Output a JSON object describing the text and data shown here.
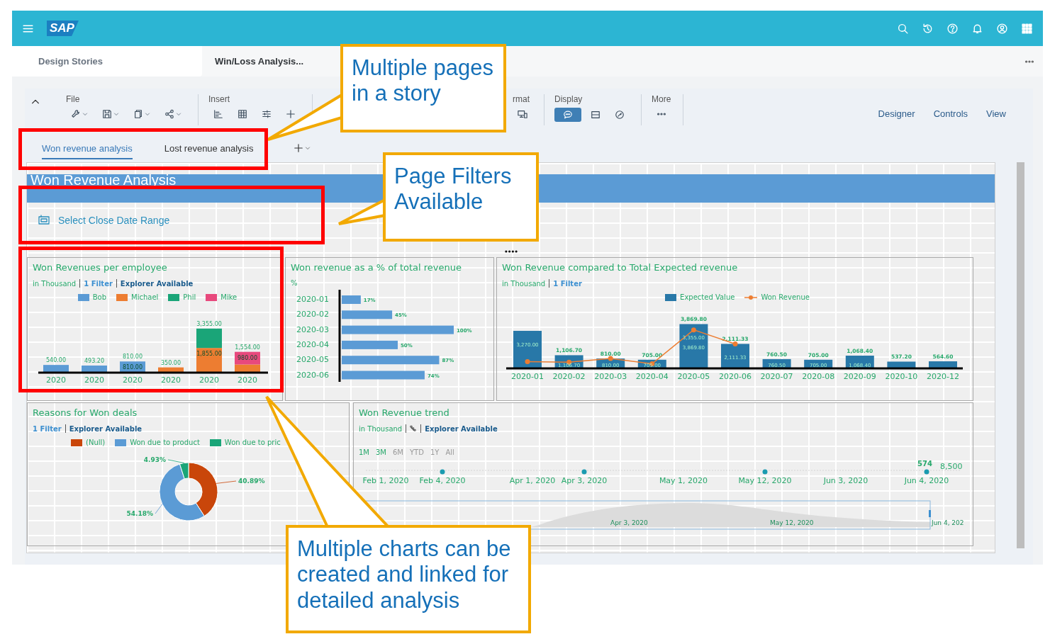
{
  "header": {
    "logo": "SAP",
    "icons": [
      {
        "kind": "search"
      },
      {
        "kind": "history"
      },
      {
        "kind": "help"
      },
      {
        "kind": "bell"
      },
      {
        "kind": "user"
      },
      {
        "kind": "grid"
      }
    ]
  },
  "doc_tabs": [
    {
      "label": "Design Stories",
      "selected": false
    },
    {
      "label": "Win/Loss Analysis...",
      "selected": true
    }
  ],
  "toolbar": {
    "groups": [
      {
        "label": "File",
        "tools": [
          {
            "kind": "wrench",
            "has_menu": true,
            "selected": false
          },
          {
            "kind": "save",
            "has_menu": true,
            "selected": false
          },
          {
            "kind": "copy",
            "has_menu": true,
            "selected": false
          },
          {
            "kind": "share",
            "has_menu": true,
            "selected": false
          }
        ]
      },
      {
        "label": "Insert",
        "tools": [
          {
            "kind": "chart",
            "has_menu": false,
            "selected": false
          },
          {
            "kind": "table",
            "has_menu": false,
            "selected": false
          },
          {
            "kind": "filter",
            "has_menu": false,
            "selected": false
          },
          {
            "kind": "add",
            "has_menu": false,
            "selected": false
          }
        ]
      },
      {
        "label": "rmat",
        "tools": [
          {
            "kind": "device",
            "has_menu": false,
            "selected": false
          }
        ]
      },
      {
        "label": "Display",
        "tools": [
          {
            "kind": "comment",
            "has_menu": false,
            "selected": true
          },
          {
            "kind": "split",
            "has_menu": false,
            "selected": false
          },
          {
            "kind": "gauge",
            "has_menu": false,
            "selected": false
          }
        ]
      },
      {
        "label": "More",
        "tools": [
          {
            "kind": "more",
            "has_menu": false,
            "selected": false
          }
        ]
      }
    ],
    "modes": [
      "Designer",
      "Controls",
      "View"
    ]
  },
  "page_tabs": [
    {
      "label": "Won revenue analysis",
      "selected": true
    },
    {
      "label": "Lost revenue analysis",
      "selected": false
    }
  ],
  "canvas": {
    "banner": "Won Revenue Analysis",
    "filter": "Select Close Date Range",
    "charts": [
      {
        "title": "Won Revenues per employee",
        "subtitle": [
          {
            "kind": "unit",
            "text": "in Thousand"
          },
          {
            "kind": "filter",
            "text": "1 Filter"
          },
          {
            "kind": "explorer",
            "text": "Explorer Available"
          }
        ],
        "chart_data": {
          "type": "bar",
          "stacked": true,
          "categories": [
            "2020",
            "2020",
            "2020",
            "2020",
            "2020",
            "2020"
          ],
          "series": [
            {
              "name": "Bob",
              "color": "#5b9bd5",
              "values": [
                540,
                493.2,
                810,
                null,
                null,
                null
              ],
              "value_labels": [
                null,
                null,
                "810.00",
                null,
                null,
                null
              ]
            },
            {
              "name": "Michael",
              "color": "#ed7d31",
              "values": [
                null,
                null,
                null,
                350,
                1855,
                574
              ],
              "value_labels": [
                null,
                null,
                null,
                null,
                "1,855.00",
                null
              ]
            },
            {
              "name": "Phil",
              "color": "#1aa578",
              "values": [
                null,
                null,
                null,
                null,
                1500,
                null
              ],
              "value_labels": [
                null,
                null,
                null,
                null,
                null,
                null
              ]
            },
            {
              "name": "Mike",
              "color": "#e8497d",
              "values": [
                null,
                null,
                null,
                null,
                null,
                980
              ],
              "value_labels": [
                null,
                null,
                null,
                null,
                null,
                "980.00"
              ]
            }
          ],
          "annotations": [
            "540.00",
            "493.20",
            "810.00",
            "350.00",
            "3,355.00",
            "1,554.00"
          ]
        }
      },
      {
        "title": "Won revenue as a % of total revenue",
        "subtitle": [
          {
            "kind": "unit",
            "text": "%"
          }
        ],
        "chart_data": {
          "type": "bar",
          "orientation": "horizontal",
          "categories": [
            "2020-01",
            "2020-02",
            "2020-03",
            "2020-04",
            "2020-05",
            "2020-06"
          ],
          "series": [
            {
              "color": "#5b9bd5",
              "values": [
                17,
                45,
                100,
                50,
                87,
                74
              ],
              "value_labels": [
                "17%",
                "45%",
                "100%",
                "50%",
                "87%",
                "74%"
              ]
            }
          ]
        }
      },
      {
        "title": "Won Revenue compared to Total Expected revenue",
        "subtitle": [
          {
            "kind": "unit",
            "text": "in Thousand"
          },
          {
            "kind": "filter",
            "text": "1 Filter"
          }
        ],
        "chart_data": {
          "type": "bar",
          "categories": [
            "2020-01",
            "2020-02",
            "2020-03",
            "2020-04",
            "2020-05",
            "2020-06",
            "2020-07",
            "2020-08",
            "2020-09",
            "2020-10",
            "2020-12"
          ],
          "series": [
            {
              "name": "Expected Value",
              "type": "bar",
              "color": "#2878a8",
              "values": [
                3270,
                1106.7,
                810,
                705,
                3869.8,
                2111.33,
                760.5,
                705,
                1068.4,
                537.2,
                564.6
              ],
              "value_labels": [
                null,
                "1,106.70",
                "810.00",
                "705.00",
                "3,869.80",
                "2,111.33",
                "760.50",
                "705.00",
                "1,068.40",
                "537.20",
                "564.60"
              ]
            },
            {
              "name": "Won Revenue",
              "type": "line",
              "marker": "circle",
              "color": "#ed7d31",
              "values": [
                540,
                493.2,
                810,
                350,
                3355,
                2111.33,
                null,
                null,
                null,
                null,
                null
              ]
            }
          ],
          "annotations": [
            "3,270.00",
            "1,106.70",
            "810.00",
            "705.00",
            "3,355.00",
            "3,869.80",
            "2,111.33",
            "760.50",
            "705.00",
            "1,068.40"
          ]
        }
      },
      {
        "title": "Reasons for Won deals",
        "subtitle": [
          {
            "kind": "filter",
            "text": "1 Filter"
          },
          {
            "kind": "explorer",
            "text": "Explorer Available"
          }
        ],
        "chart_data": {
          "type": "donut",
          "categories": [
            "(Null)",
            "Won due to product",
            "Won due to pric"
          ],
          "values": [
            40.89,
            54.18,
            4.93
          ],
          "colors": [
            "#c9460a",
            "#5b9bd5",
            "#1aa578"
          ],
          "value_labels": [
            "40.89%",
            "54.18%",
            "4.93%"
          ]
        }
      },
      {
        "kind": "trend",
        "title": "Won Revenue trend",
        "subtitle": [
          {
            "kind": "unit",
            "text": "in Thousand"
          },
          {
            "kind": "drill"
          },
          {
            "kind": "explorer",
            "text": "Explorer Available"
          }
        ],
        "ranges": [
          {
            "label": "1M",
            "disabled": false
          },
          {
            "label": "3M",
            "disabled": false
          },
          {
            "label": "6M",
            "disabled": true
          },
          {
            "label": "YTD",
            "disabled": true
          },
          {
            "label": "1Y",
            "disabled": true
          },
          {
            "label": "All",
            "disabled": true
          }
        ],
        "dates": [
          "Feb 1, 2020",
          "Feb 4, 2020",
          "Apr 1, 2020",
          "Apr 3, 2020",
          "May 1, 2020",
          "May 12, 2020",
          "Jun 3, 2020",
          "Jun 4, 2020"
        ],
        "point_labels": [
          "574",
          "8,500"
        ],
        "navigator_dates": [
          "Apr 3, 2020",
          "May 12, 2020",
          "Jun 4, 202"
        ]
      }
    ]
  },
  "callouts": [
    "Multiple pages\nin a story",
    "Page Filters\nAvailable",
    "Multiple charts can be\ncreated and linked for\ndetailed analysis"
  ]
}
